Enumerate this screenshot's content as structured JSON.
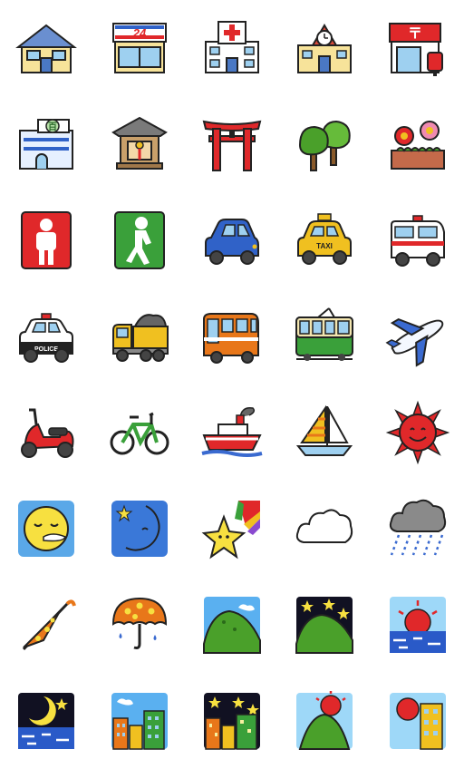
{
  "sheet": {
    "title": "",
    "icons": [
      {
        "name": "house-icon"
      },
      {
        "name": "convenience-store-icon",
        "text": "24"
      },
      {
        "name": "hospital-icon"
      },
      {
        "name": "school-icon"
      },
      {
        "name": "post-office-icon"
      },
      {
        "name": "department-store-icon",
        "text": "百"
      },
      {
        "name": "temple-icon"
      },
      {
        "name": "torii-gate-icon"
      },
      {
        "name": "trees-icon"
      },
      {
        "name": "flower-bed-icon"
      },
      {
        "name": "pedestrian-stop-signal-icon"
      },
      {
        "name": "pedestrian-go-signal-icon"
      },
      {
        "name": "car-icon"
      },
      {
        "name": "taxi-icon",
        "text": "TAXI"
      },
      {
        "name": "ambulance-icon"
      },
      {
        "name": "police-car-icon",
        "text": "POLICE"
      },
      {
        "name": "dump-truck-icon"
      },
      {
        "name": "bus-icon"
      },
      {
        "name": "train-icon"
      },
      {
        "name": "airplane-icon"
      },
      {
        "name": "scooter-icon"
      },
      {
        "name": "bicycle-icon"
      },
      {
        "name": "ship-icon"
      },
      {
        "name": "sailboat-icon"
      },
      {
        "name": "sun-icon"
      },
      {
        "name": "sleeping-face-icon"
      },
      {
        "name": "crescent-moon-icon"
      },
      {
        "name": "shooting-star-icon"
      },
      {
        "name": "cloud-icon"
      },
      {
        "name": "rain-cloud-icon"
      },
      {
        "name": "closed-umbrella-icon"
      },
      {
        "name": "umbrella-rain-icon"
      },
      {
        "name": "mountain-day-icon"
      },
      {
        "name": "mountain-night-icon"
      },
      {
        "name": "sunset-sea-icon"
      },
      {
        "name": "moon-sea-icon"
      },
      {
        "name": "city-day-icon"
      },
      {
        "name": "city-night-icon"
      },
      {
        "name": "mountain-sunrise-icon"
      },
      {
        "name": "city-sunrise-icon"
      }
    ]
  }
}
